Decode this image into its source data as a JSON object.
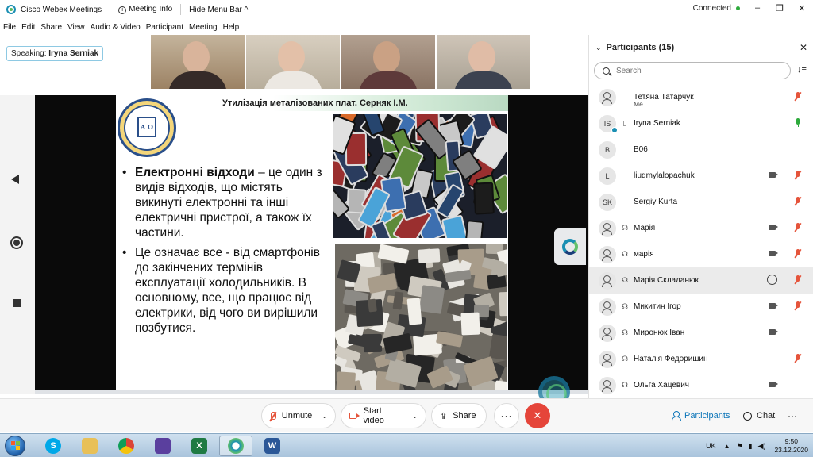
{
  "window": {
    "app_title": "Cisco Webex Meetings",
    "meeting_info": "Meeting Info",
    "hide_menu": "Hide Menu Bar",
    "caret": "^",
    "connection": "Connected",
    "controls": [
      "–",
      "❐",
      "✕"
    ]
  },
  "menu": [
    "File",
    "Edit",
    "Share",
    "View",
    "Audio & Video",
    "Participant",
    "Meeting",
    "Help"
  ],
  "speaking": {
    "label": "Speaking:",
    "name": "Iryna Serniak"
  },
  "slide": {
    "title": "Утилізація металізованих плат. Серняк І.М.",
    "seal_text": "Α Ω",
    "bullet1_bold": "Електронні відходи",
    "bullet1_text": " – це один з видів відходів, що містять викинуті електронні та інші електричні пристрої, а також їх частини.",
    "bullet2_text": "Це означає все - від смартфонів до закінчених термінів експлуатації холодильників. В основному, все, що працює від електрики, від чого ви вирішили позбутися."
  },
  "panel": {
    "title": "Participants (15)",
    "chevron": "⌄",
    "close": "✕",
    "search_placeholder": "Search",
    "sort": "↓≡"
  },
  "participants": [
    {
      "name": "Тетяна Татарчук",
      "sub": "Me",
      "initials": "",
      "device": "",
      "cam": false,
      "chat": false,
      "mic": "muted"
    },
    {
      "name": "Iryna Serniak",
      "sub": "",
      "initials": "IS",
      "device": "▯",
      "cam": false,
      "chat": false,
      "mic": "on"
    },
    {
      "name": "B06",
      "sub": "",
      "initials": "B",
      "device": "",
      "cam": false,
      "chat": false,
      "mic": ""
    },
    {
      "name": "liudmylalopachuk",
      "sub": "",
      "initials": "L",
      "device": "",
      "cam": true,
      "chat": false,
      "mic": "muted"
    },
    {
      "name": "Sergiy Kurta",
      "sub": "",
      "initials": "SK",
      "device": "",
      "cam": false,
      "chat": false,
      "mic": "muted"
    },
    {
      "name": "Марія",
      "sub": "",
      "initials": "",
      "device": "☊",
      "cam": true,
      "chat": false,
      "mic": "muted"
    },
    {
      "name": "марія",
      "sub": "",
      "initials": "",
      "device": "☊",
      "cam": true,
      "chat": false,
      "mic": "muted"
    },
    {
      "name": "Марія Складанюк",
      "sub": "",
      "initials": "",
      "device": "☊",
      "cam": false,
      "chat": true,
      "mic": "muted"
    },
    {
      "name": "Микитин Ігор",
      "sub": "",
      "initials": "",
      "device": "☊",
      "cam": true,
      "chat": false,
      "mic": "muted"
    },
    {
      "name": "Миронюк Іван",
      "sub": "",
      "initials": "",
      "device": "☊",
      "cam": true,
      "chat": false,
      "mic": ""
    },
    {
      "name": "Наталія Федоришин",
      "sub": "",
      "initials": "",
      "device": "☊",
      "cam": false,
      "chat": false,
      "mic": "muted"
    },
    {
      "name": "Ольга Хацевич",
      "sub": "",
      "initials": "",
      "device": "☊",
      "cam": true,
      "chat": false,
      "mic": ""
    }
  ],
  "bottom": {
    "unmute": "Unmute",
    "start_video": "Start video",
    "share": "Share",
    "share_icon": "⇪",
    "more": "···",
    "end": "✕",
    "participants": "Participants",
    "chat": "Chat",
    "more2": "···",
    "caret": "⌄"
  },
  "taskbar": {
    "lang": "UK",
    "tray_up": "▲",
    "time": "9:50",
    "date": "23.12.2020",
    "skype": "S",
    "excel": "X",
    "word": "W"
  },
  "colors": {
    "accent": "#0a74b8",
    "end": "#e5453a",
    "muted": "#e5543b",
    "on": "#2eaa3c"
  }
}
